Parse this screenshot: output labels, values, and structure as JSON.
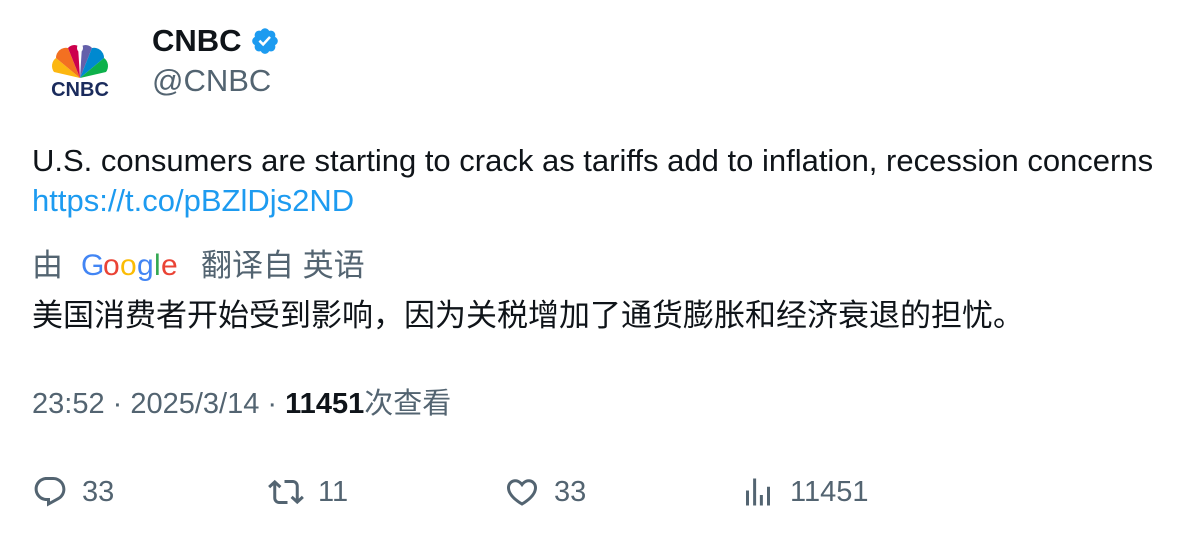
{
  "author": {
    "display_name": "CNBC",
    "handle": "@CNBC",
    "verified_icon": "verified-badge-icon",
    "avatar_text": "CNBC"
  },
  "tweet": {
    "text": "U.S. consumers are starting to crack as tariffs add to inflation, recession concerns ",
    "link": "https://t.co/pBZlDjs2ND"
  },
  "translation": {
    "prefix": "由",
    "google": {
      "G": "G",
      "o1": "o",
      "o2": "o",
      "g": "g",
      "l": "l",
      "e": "e"
    },
    "suffix": "翻译自 英语",
    "text": "美国消费者开始受到影响，因为关税增加了通货膨胀和经济衰退的担忧。"
  },
  "meta": {
    "time": "23:52",
    "sep1": " · ",
    "date": "2025/3/14",
    "sep2": " · ",
    "views_count": "11451",
    "views_suffix": "次查看"
  },
  "actions": {
    "reply_count": "33",
    "retweet_count": "11",
    "like_count": "33",
    "views_count": "11451"
  },
  "colors": {
    "text": "#0f1419",
    "secondary": "#536471",
    "link": "#1d9bf0",
    "verified": "#1d9bf0"
  }
}
